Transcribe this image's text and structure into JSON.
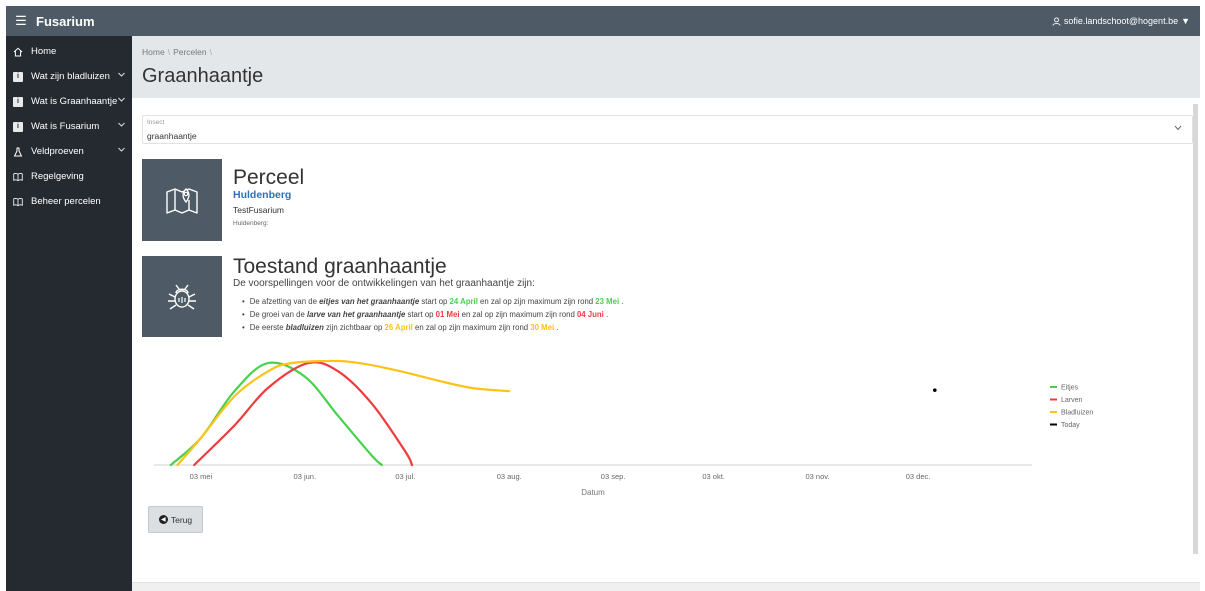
{
  "app": {
    "brand": "Fusarium",
    "user": "sofie.landschoot@hogent.be"
  },
  "sidebar": {
    "items": [
      {
        "label": "Home",
        "icon": "home-icon"
      },
      {
        "label": "Wat zijn bladluizen",
        "icon": "info-icon"
      },
      {
        "label": "Wat is Graanhaantje",
        "icon": "info-icon"
      },
      {
        "label": "Wat is Fusarium",
        "icon": "info-icon"
      },
      {
        "label": "Veldproeven",
        "icon": "flask-icon"
      },
      {
        "label": "Regelgeving",
        "icon": "book-icon"
      },
      {
        "label": "Beheer percelen",
        "icon": "book-icon"
      }
    ]
  },
  "breadcrumb": [
    "Home",
    "Percelen"
  ],
  "page_title": "Graanhaantje",
  "insect_select": {
    "label": "Insect",
    "value": "graanhaantje"
  },
  "perceel": {
    "heading": "Perceel",
    "link": "Huldenberg",
    "name": "TestFusarium",
    "location": "Huldenberg:"
  },
  "toestand": {
    "heading": "Toestand graanhaantje",
    "subtitle": "De voorspellingen voor de ontwikkelingen van het graanhaantje zijn:",
    "b1": {
      "t1": "De afzetting van de ",
      "em": "eitjes van het graanhaantje",
      "t2": " start op ",
      "d1": "24 April",
      "t3": " en zal op zijn maximum zijn rond ",
      "d2": "23 Mei",
      "t4": " ."
    },
    "b2": {
      "t1": "De groei van de ",
      "em": "larve van het graanhaantje",
      "t2": " start op ",
      "d1": "01 Mei",
      "t3": " en zal op zijn maximum zijn rond ",
      "d2": "04 Juni",
      "t4": " ."
    },
    "b3": {
      "t1": "De eerste ",
      "em": "bladluizen",
      "t2": " zijn zichtbaar op ",
      "d1": "26 April",
      "t3": " en zal op zijn maximum zijn rond ",
      "d2": "30 Mei",
      "t4": " ."
    }
  },
  "back_button": "Terug",
  "colors": {
    "green": "#47d14c",
    "red": "#ef3b3b",
    "orange": "#ffc21a",
    "panel": "#4e5a66",
    "sidebar": "#252a30"
  },
  "chart_data": {
    "type": "line",
    "xlabel": "Datum",
    "ylabel": "",
    "x_tick_labels": [
      "03 mei",
      "03 jun.",
      "03 jul.",
      "03 aug.",
      "03 sep.",
      "03 okt.",
      "03 nov.",
      "03 dec."
    ],
    "x_tick_dates": [
      "2023-05-03",
      "2023-06-03",
      "2023-07-03",
      "2023-08-03",
      "2023-09-03",
      "2023-10-03",
      "2023-11-03",
      "2023-12-03"
    ],
    "xlim": [
      "2023-04-19",
      "2024-01-06"
    ],
    "ylim": [
      0,
      1
    ],
    "legend_position": "right",
    "series": [
      {
        "name": "Eitjes",
        "color": "#47d14c",
        "points": [
          [
            "2023-04-24",
            0
          ],
          [
            "2023-05-03",
            0.26
          ],
          [
            "2023-05-13",
            0.71
          ],
          [
            "2023-05-23",
            0.98
          ],
          [
            "2023-06-03",
            0.85
          ],
          [
            "2023-06-13",
            0.47
          ],
          [
            "2023-06-23",
            0.09
          ],
          [
            "2023-06-26",
            0
          ]
        ]
      },
      {
        "name": "Larven",
        "color": "#ef3b3b",
        "points": [
          [
            "2023-05-01",
            0
          ],
          [
            "2023-05-13",
            0.38
          ],
          [
            "2023-05-23",
            0.74
          ],
          [
            "2023-06-04",
            0.98
          ],
          [
            "2023-06-13",
            0.9
          ],
          [
            "2023-06-23",
            0.59
          ],
          [
            "2023-07-03",
            0.13
          ],
          [
            "2023-07-05",
            0
          ]
        ]
      },
      {
        "name": "Bladluizen",
        "color": "#ffc21a",
        "points": [
          [
            "2023-04-26",
            0
          ],
          [
            "2023-05-03",
            0.26
          ],
          [
            "2023-05-13",
            0.66
          ],
          [
            "2023-05-23",
            0.9
          ],
          [
            "2023-05-30",
            0.98
          ],
          [
            "2023-06-13",
            1.0
          ],
          [
            "2023-06-23",
            0.96
          ],
          [
            "2023-07-03",
            0.89
          ],
          [
            "2023-07-13",
            0.81
          ],
          [
            "2023-07-23",
            0.74
          ],
          [
            "2023-08-03",
            0.71
          ]
        ]
      },
      {
        "name": "Today",
        "color": "#000000",
        "points": [
          [
            "2023-12-08",
            0.72
          ]
        ]
      }
    ]
  }
}
